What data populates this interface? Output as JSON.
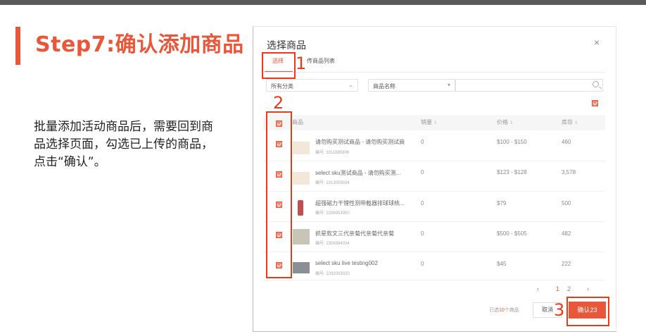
{
  "slide": {
    "step_title": "Step7:确认添加商品",
    "description": "批量添加活动商品后，需要回到商品选择页面，勾选已上传的商品，点击“确认”。"
  },
  "modal": {
    "title": "选择商品",
    "close_icon": "×",
    "tabs": [
      {
        "label": "选择",
        "active": true
      },
      {
        "label": "传商品列表",
        "active": false
      }
    ],
    "filters": {
      "category": "所有分类",
      "field": "商品名称",
      "search_value": ""
    },
    "columns": {
      "product": "商品",
      "sales": "销量",
      "price": "价格",
      "stock": "库存",
      "sort_icon": "⇕"
    },
    "rows": [
      {
        "name": "请勿购买测试商品 - 请勿购买测试商",
        "id": "编号: 3311885806",
        "sales": "0",
        "price": "$100 - $150",
        "stock": "460",
        "checked": true
      },
      {
        "name": "select sku测试商品 - 请勿购买测...",
        "id": "编号: 2313009034",
        "sales": "0",
        "price": "$123 - $128",
        "stock": "3,578",
        "checked": true
      },
      {
        "name": "超强磁力干锂性测带截器排球球桃...",
        "id": "编号: 2336953950",
        "sales": "0",
        "price": "$79",
        "stock": "500",
        "checked": true
      },
      {
        "name": "抓星款文三代亲菊代亲菊代亲菊",
        "id": "编号: 2306984034",
        "sales": "0",
        "price": "$500 - $505",
        "stock": "482",
        "checked": true
      },
      {
        "name": "select sku live testing002",
        "id": "编号: 2332003020",
        "sales": "0",
        "price": "$45",
        "stock": "222",
        "checked": true
      }
    ],
    "pagination": {
      "prev": "‹",
      "pages": [
        "1",
        "2"
      ],
      "current": "1",
      "next": "›"
    },
    "footer": {
      "selected_prefix": "已选",
      "selected_count": "10",
      "selected_suffix": "个商品",
      "cancel": "取消",
      "confirm": "确认"
    }
  },
  "annotations": {
    "n1": "1",
    "n2": "2",
    "n3": "3",
    "confirm_suffix": "23"
  },
  "colors": {
    "accent": "#e8573a",
    "annotation": "#e83b1a"
  }
}
